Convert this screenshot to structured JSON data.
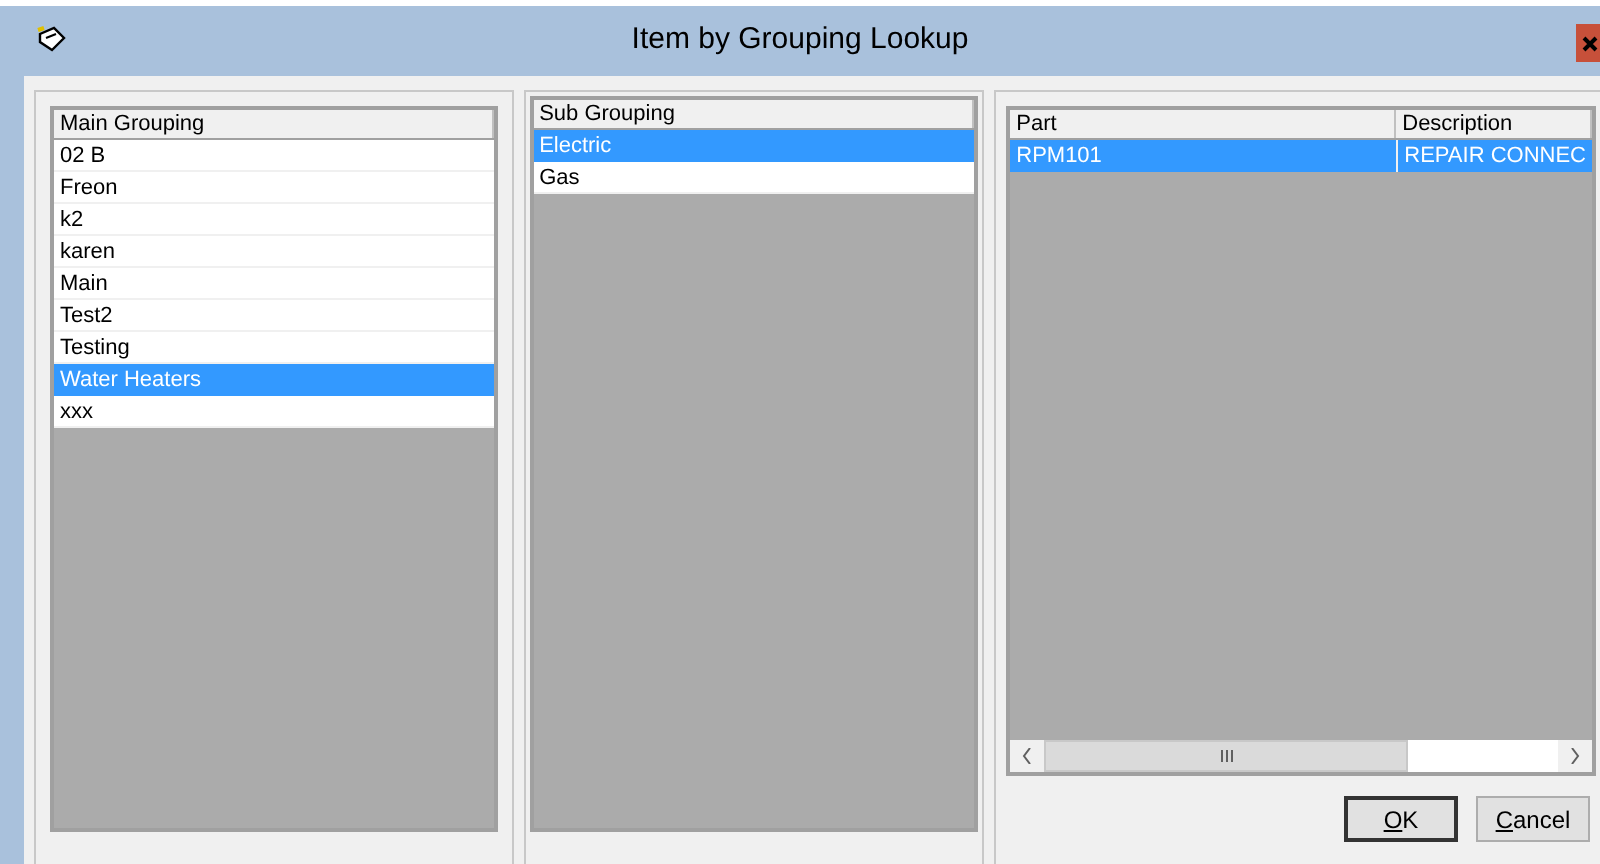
{
  "window": {
    "title": "Item by Grouping Lookup"
  },
  "main_grouping": {
    "columns": [
      "Main Grouping"
    ],
    "rows": [
      {
        "cells": [
          "02 B"
        ],
        "selected": false
      },
      {
        "cells": [
          "Freon"
        ],
        "selected": false
      },
      {
        "cells": [
          "k2"
        ],
        "selected": false
      },
      {
        "cells": [
          "karen"
        ],
        "selected": false
      },
      {
        "cells": [
          "Main"
        ],
        "selected": false
      },
      {
        "cells": [
          "Test2"
        ],
        "selected": false
      },
      {
        "cells": [
          "Testing"
        ],
        "selected": false
      },
      {
        "cells": [
          "Water Heaters"
        ],
        "selected": true
      },
      {
        "cells": [
          "xxx"
        ],
        "selected": false
      }
    ]
  },
  "sub_grouping": {
    "columns": [
      "Sub Grouping"
    ],
    "rows": [
      {
        "cells": [
          "Electric"
        ],
        "selected": true
      },
      {
        "cells": [
          "Gas"
        ],
        "selected": false
      }
    ]
  },
  "parts": {
    "columns": [
      "Part",
      "Description"
    ],
    "rows": [
      {
        "cells": [
          "RPM101",
          "REPAIR CONNEC"
        ],
        "selected": true
      }
    ]
  },
  "buttons": [
    {
      "label_parts": [
        {
          "text": "O",
          "underlined": true
        },
        {
          "text": "K",
          "underlined": false
        }
      ]
    },
    {
      "label_parts": [
        {
          "text": "C",
          "underlined": true
        },
        {
          "text": "ancel",
          "underlined": false
        }
      ]
    }
  ]
}
